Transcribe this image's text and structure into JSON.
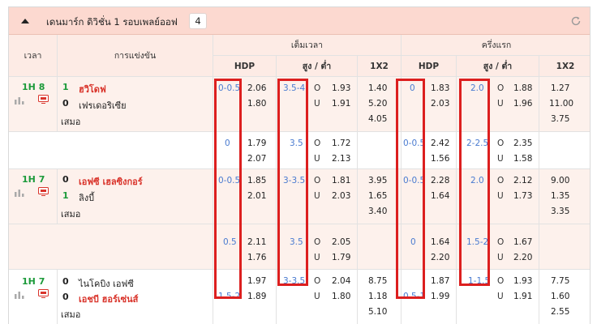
{
  "league": {
    "title": "เดนมาร์ก ดิวิชั่น 1 รอบเพลย์ออฟ",
    "count": "4"
  },
  "headers": {
    "time": "เวลา",
    "match": "การแข่งขัน",
    "fulltime": "เต็มเวลา",
    "firsthalf": "ครึ่งแรก",
    "hdp": "HDP",
    "ou": "สูง / ต่ำ",
    "x12": "1X2"
  },
  "labels": {
    "over": "O",
    "under": "U"
  },
  "matches": [
    {
      "time": "1H 8",
      "home": {
        "score": "1",
        "name": "ฮวิโดฟ"
      },
      "away": {
        "score": "0",
        "name": "เฟรเดอริเซีย"
      },
      "draw": "เสมอ",
      "lines": [
        {
          "ft_hdp": {
            "line": "0-0.5",
            "home": "2.06",
            "away": "1.80"
          },
          "ft_ou": {
            "line": "3.5-4",
            "over": "1.93",
            "under": "1.91"
          },
          "ft_1x2": {
            "home": "1.40",
            "away": "5.20",
            "draw": "4.05"
          },
          "fh_hdp": {
            "line": "0",
            "home": "1.83",
            "away": "2.03"
          },
          "fh_ou": {
            "line": "2.0",
            "over": "1.88",
            "under": "1.96"
          },
          "fh_1x2": {
            "home": "1.27",
            "away": "11.00",
            "draw": "3.75"
          }
        },
        {
          "ft_hdp": {
            "line": "0",
            "home": "1.79",
            "away": "2.07"
          },
          "ft_ou": {
            "line": "3.5",
            "over": "1.72",
            "under": "2.13"
          },
          "fh_hdp": {
            "line": "0-0.5",
            "home": "2.42",
            "away": "1.56"
          },
          "fh_ou": {
            "line": "2-2.5",
            "over": "2.35",
            "under": "1.58"
          }
        }
      ]
    },
    {
      "time": "1H 7",
      "home": {
        "score": "0",
        "name": "เอฟซี เฮลซิงกอร์"
      },
      "away": {
        "score": "1",
        "name": "ลิงบี้"
      },
      "draw": "เสมอ",
      "lines": [
        {
          "ft_hdp": {
            "line": "0-0.5",
            "home": "1.85",
            "away": "2.01"
          },
          "ft_ou": {
            "line": "3-3.5",
            "over": "1.81",
            "under": "2.03"
          },
          "ft_1x2": {
            "home": "3.95",
            "away": "1.65",
            "draw": "3.40"
          },
          "fh_hdp": {
            "line": "0-0.5",
            "home": "2.28",
            "away": "1.64"
          },
          "fh_ou": {
            "line": "2.0",
            "over": "2.12",
            "under": "1.73"
          },
          "fh_1x2": {
            "home": "9.00",
            "away": "1.35",
            "draw": "3.35"
          }
        },
        {
          "ft_hdp": {
            "line": "0.5",
            "home": "2.11",
            "away": "1.76"
          },
          "ft_ou": {
            "line": "3.5",
            "over": "2.05",
            "under": "1.79"
          },
          "fh_hdp": {
            "line": "0",
            "home": "1.64",
            "away": "2.20"
          },
          "fh_ou": {
            "line": "1.5-2",
            "over": "1.67",
            "under": "2.20"
          }
        }
      ]
    },
    {
      "time": "1H 7",
      "home": {
        "score": "0",
        "name": "ไนโคบิง เอฟซี"
      },
      "away": {
        "score": "0",
        "name": "เอชบี ฮอร์เซ่นส์"
      },
      "draw": "เสมอ",
      "lines": [
        {
          "ft_hdp": {
            "line": "1.5-2",
            "home": "1.97",
            "away": "1.89"
          },
          "ft_ou": {
            "line": "3-3.5",
            "over": "2.04",
            "under": "1.80"
          },
          "ft_1x2": {
            "home": "8.75",
            "away": "1.18",
            "draw": "5.10"
          },
          "fh_hdp": {
            "line": "0.5-1",
            "home": "1.87",
            "away": "1.99"
          },
          "fh_ou": {
            "line": "1-1.5",
            "over": "1.93",
            "under": "1.91"
          },
          "fh_1x2": {
            "home": "7.75",
            "away": "1.60",
            "draw": "2.55"
          }
        }
      ]
    }
  ],
  "colors": {
    "header_bg": "#fcd9d0",
    "highlight": "#dc1f1f",
    "line_blue": "#4a7bd0",
    "time_green": "#1c9a3a",
    "team_red": "#d9342b"
  },
  "icons": [
    "chevron-up-icon",
    "refresh-icon",
    "stats-icon",
    "live-tv-icon"
  ]
}
